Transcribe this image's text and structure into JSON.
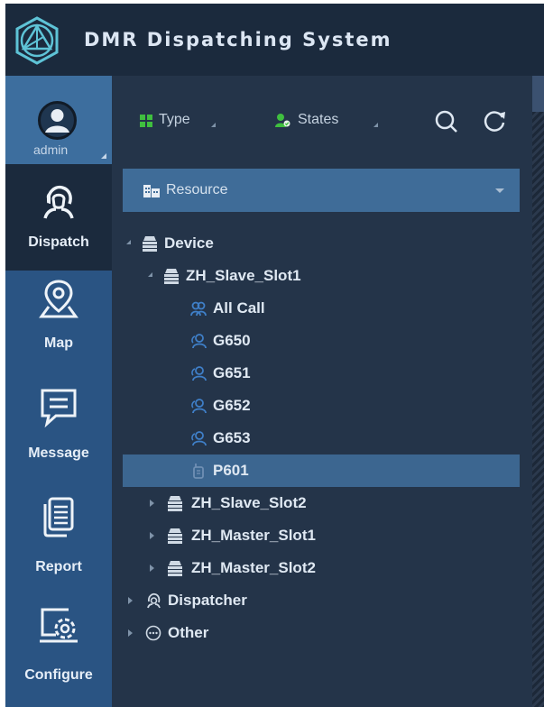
{
  "app": {
    "title": "DMR Dispatching System"
  },
  "user": {
    "name": "admin"
  },
  "nav": [
    {
      "label": "Dispatch",
      "icon": "dispatch-icon",
      "active": true
    },
    {
      "label": "Map",
      "icon": "map-pin-icon"
    },
    {
      "label": "Message",
      "icon": "message-icon"
    },
    {
      "label": "Report",
      "icon": "report-icon"
    },
    {
      "label": "Configure",
      "icon": "configure-icon"
    }
  ],
  "toolbar": {
    "type_label": "Type",
    "states_label": "States"
  },
  "resource": {
    "label": "Resource"
  },
  "tree": [
    {
      "label": "Device",
      "level": 0,
      "icon": "device-icon",
      "state": "expanded"
    },
    {
      "label": "ZH_Slave_Slot1",
      "level": 1,
      "icon": "device-icon",
      "state": "expanded"
    },
    {
      "label": "All Call",
      "level": 2,
      "icon": "all-call-icon"
    },
    {
      "label": "G650",
      "level": 2,
      "icon": "group-icon"
    },
    {
      "label": "G651",
      "level": 2,
      "icon": "group-icon"
    },
    {
      "label": "G652",
      "level": 2,
      "icon": "group-icon"
    },
    {
      "label": "G653",
      "level": 2,
      "icon": "group-icon"
    },
    {
      "label": "P601",
      "level": 2,
      "icon": "radio-icon",
      "selected": true
    },
    {
      "label": "ZH_Slave_Slot2",
      "level": 1,
      "icon": "device-icon",
      "state": "collapsed"
    },
    {
      "label": "ZH_Master_Slot1",
      "level": 1,
      "icon": "device-icon",
      "state": "collapsed"
    },
    {
      "label": "ZH_Master_Slot2",
      "level": 1,
      "icon": "device-icon",
      "state": "collapsed"
    },
    {
      "label": "Dispatcher",
      "level": 0,
      "icon": "dispatcher-icon",
      "state": "collapsed"
    },
    {
      "label": "Other",
      "level": 0,
      "icon": "other-icon",
      "state": "collapsed"
    }
  ],
  "colors": {
    "header": "#1b2a3d",
    "nav": "#2a5483",
    "panel": "#243449",
    "accent": "#5ec3d6",
    "green": "#3fbf3f"
  }
}
